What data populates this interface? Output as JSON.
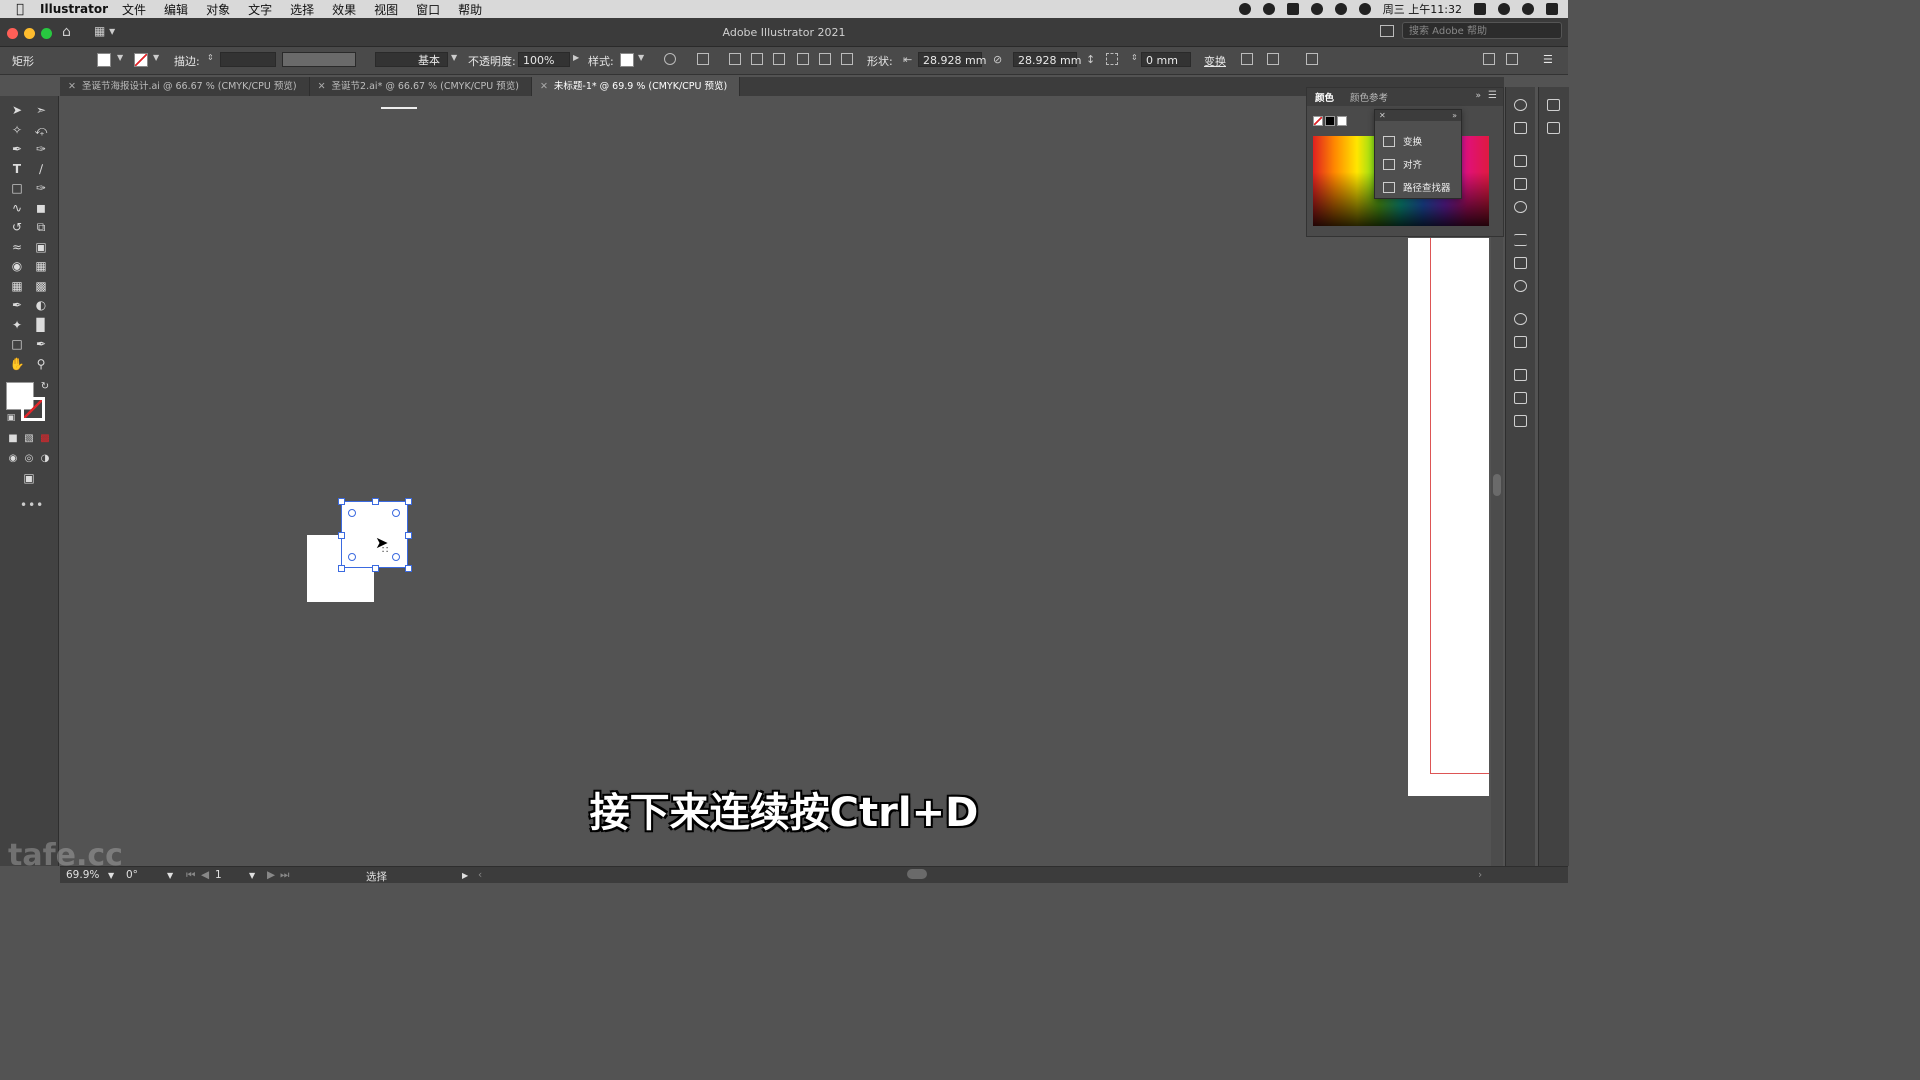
{
  "menubar": {
    "app_name": "Illustrator",
    "items": [
      "文件",
      "编辑",
      "对象",
      "文字",
      "选择",
      "效果",
      "视图",
      "窗口",
      "帮助"
    ],
    "clock": "周三 上午11:32"
  },
  "window": {
    "title": "Adobe Illustrator 2021",
    "search_placeholder": "搜索 Adobe 帮助"
  },
  "control_bar": {
    "object_type": "矩形",
    "stroke_label": "描边:",
    "stroke_style": "基本",
    "opacity_label": "不透明度:",
    "opacity_value": "100%",
    "style_label": "样式:",
    "shape_label": "形状:",
    "width": "28.928 mm",
    "height": "28.928 mm",
    "corner": "0 mm",
    "transform_label": "变换"
  },
  "tabs": [
    {
      "label": "圣诞节海报设计.ai @ 66.67 % (CMYK/CPU 预览)"
    },
    {
      "label": "圣诞节2.ai* @ 66.67 % (CMYK/CPU 预览)"
    },
    {
      "label": "未标题-1* @ 69.9 % (CMYK/CPU 预览)"
    }
  ],
  "color_panel": {
    "tab_color": "颜色",
    "tab_color_guide": "颜色参考",
    "popup_items": [
      "变换",
      "对齐",
      "路径查找器"
    ]
  },
  "status_bar": {
    "zoom": "69.9%",
    "rotation": "0°",
    "artboard": "1",
    "tool": "选择"
  },
  "subtitle": "接下来连续按Ctrl+D",
  "watermark": "tafe.cc",
  "colors": {
    "selection": "#3b6ae0",
    "canvas": "#535353",
    "accent_red": "#e0262b"
  }
}
